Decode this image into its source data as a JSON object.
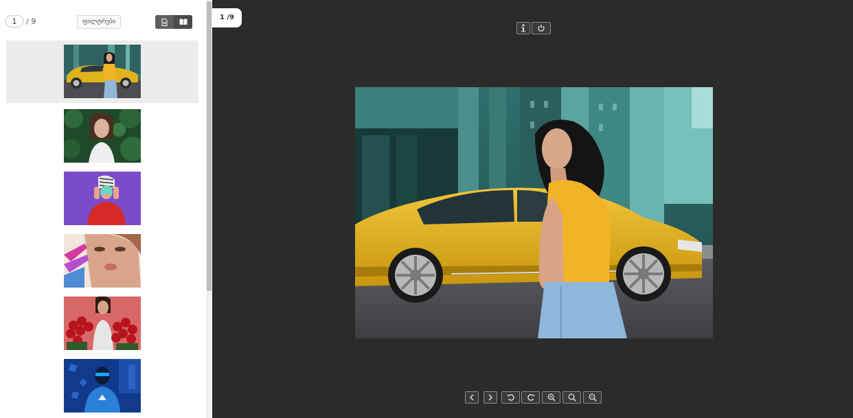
{
  "sidebar": {
    "page_input": "1",
    "page_total": "/ 9",
    "filter_label": "ფილტრები",
    "view_buttons": [
      {
        "name": "single-page-view",
        "icon": "document-icon"
      },
      {
        "name": "book-view",
        "icon": "open-book-icon"
      }
    ],
    "thumbnails": [
      {
        "index": 1,
        "subject": "woman-yellow-car",
        "selected": true
      },
      {
        "index": 2,
        "subject": "woman-green-leaves",
        "selected": false
      },
      {
        "index": 3,
        "subject": "woman-purple-background",
        "selected": false
      },
      {
        "index": 4,
        "subject": "woman-painted-hand",
        "selected": false
      },
      {
        "index": 5,
        "subject": "woman-red-roses",
        "selected": false
      },
      {
        "index": 6,
        "subject": "man-blue-cyber",
        "selected": false
      }
    ]
  },
  "viewer": {
    "page_counter": "1 /9",
    "top_controls": [
      {
        "name": "info-button",
        "icon": "info-icon"
      },
      {
        "name": "power-button",
        "icon": "power-icon"
      }
    ],
    "bottom_controls": [
      {
        "name": "previous-button",
        "icon": "chevron-left-icon"
      },
      {
        "name": "next-button",
        "icon": "chevron-right-icon"
      },
      {
        "name": "rotate-left-button",
        "icon": "rotate-ccw-icon"
      },
      {
        "name": "rotate-right-button",
        "icon": "rotate-cw-icon"
      },
      {
        "name": "zoom-in-button",
        "icon": "zoom-in-icon"
      },
      {
        "name": "zoom-reset-button",
        "icon": "search-icon"
      },
      {
        "name": "zoom-out-button",
        "icon": "zoom-out-icon"
      }
    ],
    "main_image_subject": "woman-yellow-car"
  },
  "colors": {
    "viewer_bg": "#2b2b2b",
    "selected_thumb_bg": "#ececec",
    "car_yellow": "#e0b31c",
    "top_yellow": "#f2b426"
  }
}
